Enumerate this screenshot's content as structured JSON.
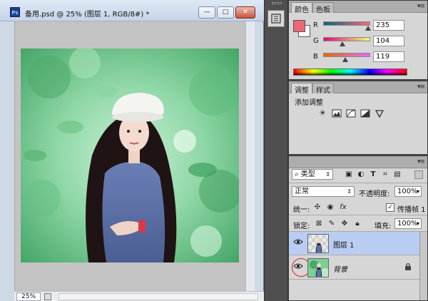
{
  "document": {
    "title": "备用.psd @ 25% (图层 1, RGB/8#) *",
    "app_icon": "Ps",
    "buttons": {
      "minimize": "—",
      "restore": "□",
      "close": "✕"
    },
    "zoom": "25%"
  },
  "toolstrip": {
    "button_icon": "history-icon"
  },
  "color_panel": {
    "tabs": [
      "颜色",
      "色板"
    ],
    "foreground_color": "#eb6877",
    "background_color": "#ffffff",
    "channels": [
      {
        "label": "R",
        "value": "235",
        "fraction": 0.92
      },
      {
        "label": "G",
        "value": "104",
        "fraction": 0.41
      },
      {
        "label": "B",
        "value": "119",
        "fraction": 0.47
      }
    ]
  },
  "adjust_panel": {
    "tabs": [
      "调整",
      "样式"
    ],
    "title": "添加调整",
    "icons": [
      "brightness-icon",
      "levels-icon",
      "curves-icon",
      "exposure-icon",
      "vibrance-icon"
    ]
  },
  "layers_panel": {
    "filter_kind": "类型",
    "blend_mode": "正常",
    "opacity_label": "不透明度:",
    "opacity_value": "100%",
    "unify_label": "统一:",
    "propagate_label": "传播帧 1",
    "lock_label": "锁定:",
    "fill_label": "填充:",
    "fill_value": "100%",
    "layers": [
      {
        "name": "图层 1",
        "selected": true,
        "visible": true,
        "locked": false
      },
      {
        "name": "背景",
        "selected": false,
        "visible": true,
        "locked": true
      }
    ]
  }
}
